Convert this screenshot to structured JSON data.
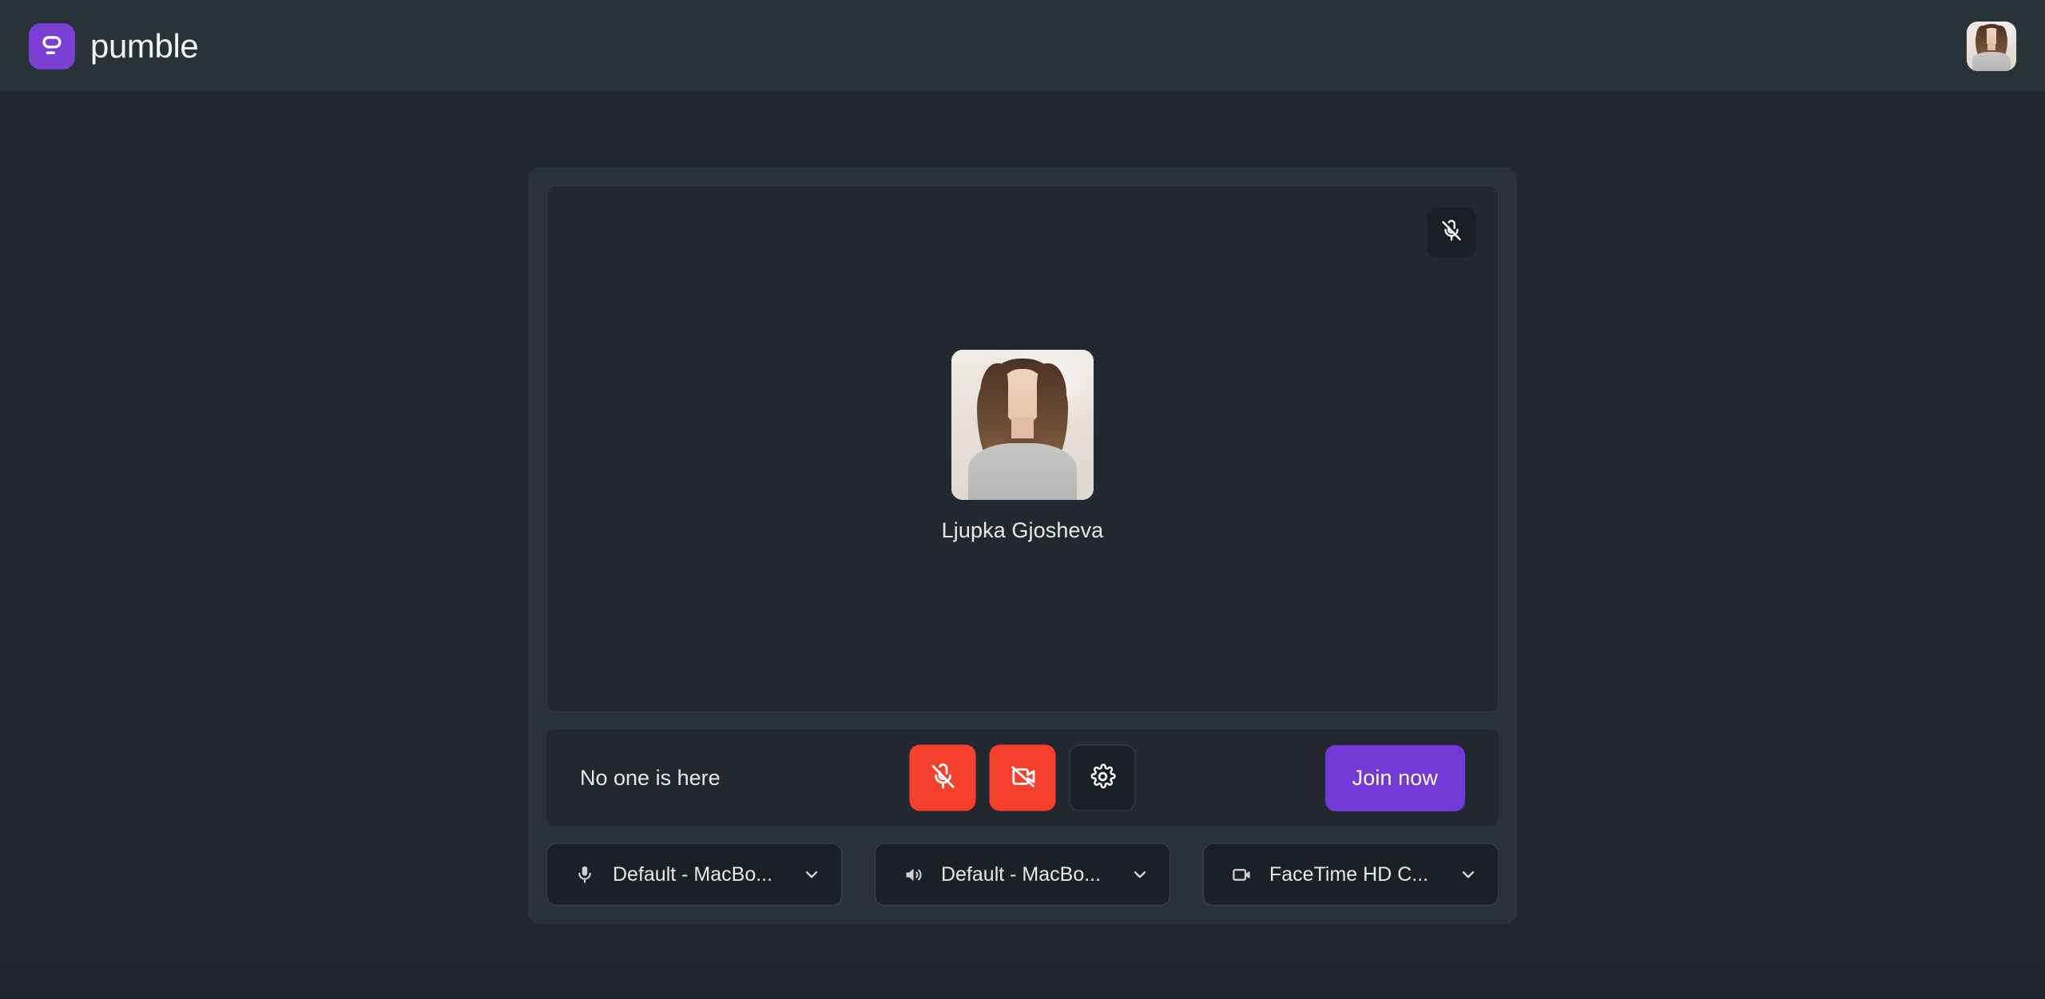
{
  "header": {
    "brand_name": "pumble",
    "logo_icon": "pumble-speech-bubble-icon",
    "logo_color": "#7b3fd4",
    "avatar_alt": "Ljupka Gjosheva"
  },
  "video_stage": {
    "mic_badge_icon": "mic-off-icon",
    "participant_name": "Ljupka Gjosheva",
    "participant_avatar_alt": "Ljupka Gjosheva"
  },
  "control_bar": {
    "status_text": "No one is here",
    "mic_button": {
      "icon": "mic-off-icon",
      "state": "muted",
      "color": "#f4402d"
    },
    "camera_button": {
      "icon": "video-off-icon",
      "state": "off",
      "color": "#f4402d"
    },
    "settings_button": {
      "icon": "gear-icon"
    },
    "join_label": "Join now",
    "join_color": "#7239d6"
  },
  "devices": {
    "microphone": {
      "icon": "microphone-icon",
      "label": "Default - MacBo...",
      "chevron": "chevron-down-icon"
    },
    "speaker": {
      "icon": "speaker-icon",
      "label": "Default - MacBo...",
      "chevron": "chevron-down-icon"
    },
    "camera": {
      "icon": "video-camera-icon",
      "label": "FaceTime HD C...",
      "chevron": "chevron-down-icon"
    }
  }
}
